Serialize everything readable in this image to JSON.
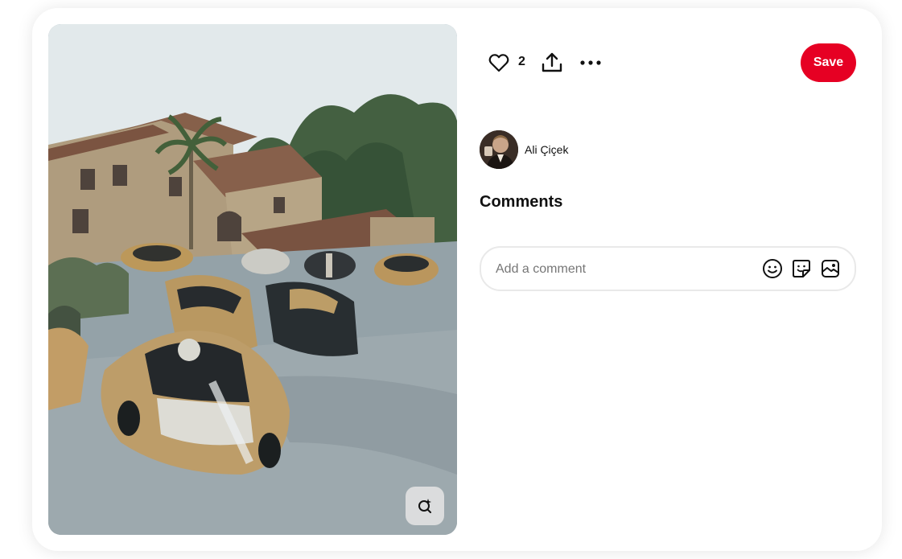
{
  "pin": {
    "image": {
      "icon": "visual-search-icon"
    },
    "actions": {
      "like_icon": "heart-icon",
      "like_count": "2",
      "share_icon": "share-icon",
      "more_icon": "ellipsis-icon",
      "save_label": "Save"
    },
    "author": {
      "name": "Ali Çiçek"
    },
    "comments": {
      "heading": "Comments",
      "input_placeholder": "Add a comment",
      "input_value": "",
      "emoji_icon": "emoji-icon",
      "sticker_icon": "sticker-icon",
      "image_icon": "image-icon"
    }
  },
  "colors": {
    "accent": "#e60023",
    "text": "#111111",
    "placeholder": "#767676",
    "border": "#e9e9e9"
  }
}
